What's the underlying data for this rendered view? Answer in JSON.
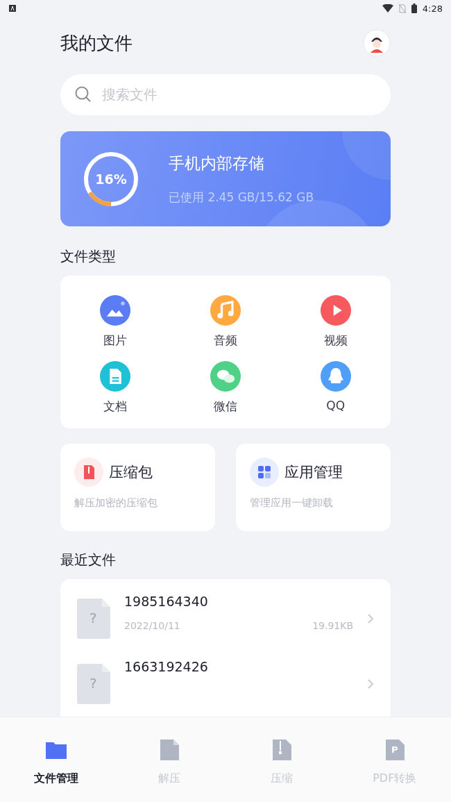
{
  "status_bar": {
    "time": "4:28"
  },
  "header": {
    "title": "我的文件"
  },
  "search": {
    "placeholder": "搜索文件"
  },
  "storage": {
    "percent": "16%",
    "level": 0.16,
    "title": "手机内部存储",
    "usage": "已使用 2.45 GB/15.62 GB"
  },
  "file_types": {
    "heading": "文件类型",
    "items": [
      {
        "label": "图片",
        "kind": "image",
        "color": "#5b7cf5"
      },
      {
        "label": "音频",
        "kind": "audio",
        "color": "#ffa940"
      },
      {
        "label": "视频",
        "kind": "video",
        "color": "#f65a5f"
      },
      {
        "label": "文档",
        "kind": "document",
        "color": "#1fc1d6"
      },
      {
        "label": "微信",
        "kind": "wechat",
        "color": "#4fd287"
      },
      {
        "label": "QQ",
        "kind": "qq",
        "color": "#4f9ef7"
      }
    ]
  },
  "tools": [
    {
      "kind": "archive",
      "title": "压缩包",
      "subtitle": "解压加密的压缩包"
    },
    {
      "kind": "apps",
      "title": "应用管理",
      "subtitle": "管理应用一键卸载"
    }
  ],
  "recent": {
    "heading": "最近文件",
    "icon_glyph": "?",
    "files": [
      {
        "name": "1985164340",
        "date": "2022/10/11",
        "size": "19.91KB"
      },
      {
        "name": "1663192426"
      }
    ]
  },
  "tabs": [
    {
      "label": "文件管理",
      "kind": "folder",
      "selected": true
    },
    {
      "label": "解压",
      "kind": "file",
      "selected": false
    },
    {
      "label": "压缩",
      "kind": "zip",
      "selected": false
    },
    {
      "label": "PDF转换",
      "kind": "pdf",
      "icon_letter": "P",
      "selected": false
    }
  ]
}
